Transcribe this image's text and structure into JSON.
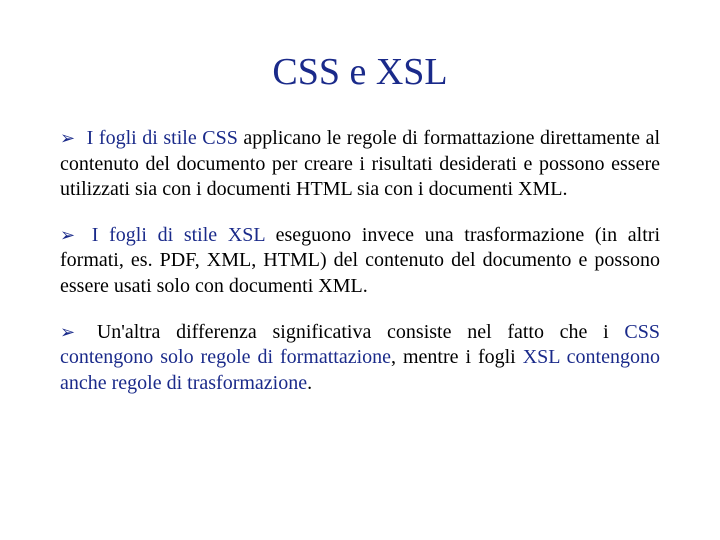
{
  "title": "CSS e XSL",
  "bullets": [
    {
      "lead": "I fogli di stile CSS",
      "rest": " applicano le regole di formattazione direttamente al contenuto del documento per creare i risultati desiderati e possono essere utilizzati sia con i documenti HTML sia con i documenti XML."
    },
    {
      "lead": "I fogli di stile XSL",
      "rest": " eseguono invece una trasformazione (in altri formati, es. PDF, XML, HTML) del contenuto del documento e possono essere usati solo con documenti XML."
    }
  ],
  "last": {
    "pre": "Un'altra differenza significativa consiste nel fatto che i ",
    "css_text": "CSS contengono solo regole di formattazione",
    "mid": ", mentre i fogli ",
    "xsl_text": "XSL contengono anche regole di trasformazione",
    "end": "."
  },
  "arrow": "➢"
}
